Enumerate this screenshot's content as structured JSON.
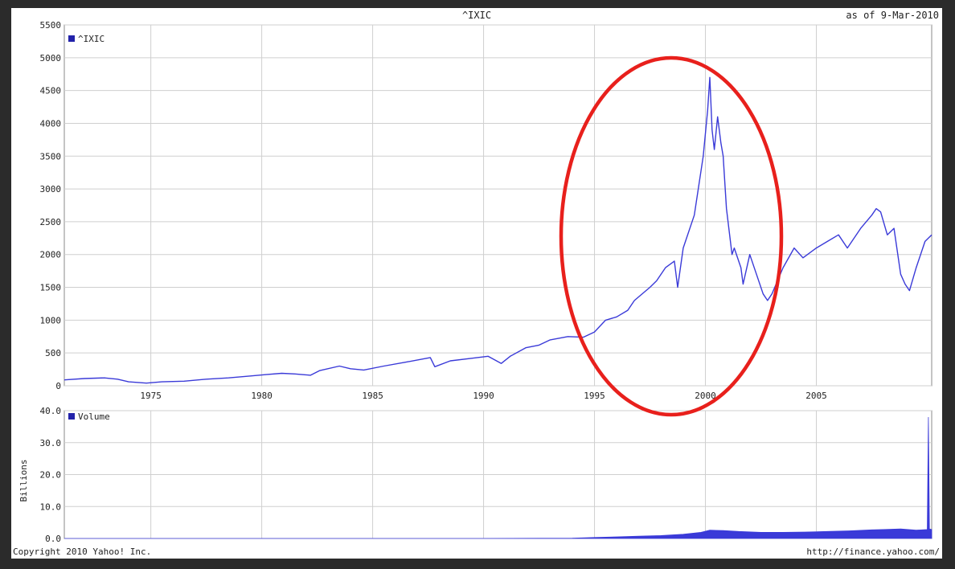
{
  "header": {
    "title": "^IXIC",
    "as_of": "as of  9-Mar-2010"
  },
  "footer": {
    "copyright": "Copyright 2010 Yahoo! Inc.",
    "url": "http://finance.yahoo.com/"
  },
  "colors": {
    "line": "#3a3ad8",
    "grid": "#cfcfcf",
    "annotation": "#e8201c",
    "background": "#2b2b2b"
  },
  "chart_data": [
    {
      "type": "line",
      "legend": "^IXIC",
      "legend_placement": "top-left",
      "grid": true,
      "xlim": [
        1971.1,
        2010.2
      ],
      "ylim": [
        0,
        5500
      ],
      "x_ticks": [
        "1975",
        "1980",
        "1985",
        "1990",
        "1995",
        "2000",
        "2005"
      ],
      "y_ticks": [
        "0",
        "500",
        "1000",
        "1500",
        "2000",
        "2500",
        "3000",
        "3500",
        "4000",
        "4500",
        "5000",
        "5500"
      ],
      "series": [
        {
          "name": "^IXIC",
          "x": [
            1971.1,
            1972.0,
            1972.9,
            1973.5,
            1974.0,
            1974.8,
            1975.5,
            1976.5,
            1977.5,
            1978.5,
            1979.5,
            1980.2,
            1980.9,
            1981.5,
            1982.2,
            1982.6,
            1983.5,
            1984.0,
            1984.6,
            1985.5,
            1986.5,
            1987.6,
            1987.8,
            1988.5,
            1989.5,
            1990.2,
            1990.8,
            1991.2,
            1991.9,
            1992.5,
            1993.0,
            1993.8,
            1994.5,
            1995.0,
            1995.5,
            1996.0,
            1996.5,
            1996.8,
            1997.5,
            1997.8,
            1998.2,
            1998.6,
            1998.75,
            1999.0,
            1999.5,
            1999.9,
            2000.1,
            2000.2,
            2000.3,
            2000.4,
            2000.55,
            2000.7,
            2000.8,
            2000.95,
            2001.2,
            2001.3,
            2001.6,
            2001.7,
            2002.0,
            2002.3,
            2002.6,
            2002.8,
            2003.0,
            2003.5,
            2004.0,
            2004.4,
            2004.6,
            2005.0,
            2005.5,
            2006.0,
            2006.4,
            2006.6,
            2007.0,
            2007.5,
            2007.7,
            2007.9,
            2008.2,
            2008.5,
            2008.8,
            2009.0,
            2009.2,
            2009.5,
            2009.9,
            2010.2
          ],
          "values": [
            90,
            110,
            120,
            100,
            60,
            40,
            60,
            70,
            100,
            120,
            150,
            170,
            190,
            180,
            160,
            230,
            300,
            260,
            240,
            300,
            360,
            430,
            290,
            380,
            420,
            450,
            340,
            450,
            580,
            620,
            700,
            750,
            740,
            820,
            1000,
            1050,
            1150,
            1300,
            1500,
            1600,
            1800,
            1900,
            1500,
            2100,
            2600,
            3500,
            4200,
            4700,
            3900,
            3600,
            4100,
            3700,
            3500,
            2700,
            2000,
            2100,
            1800,
            1550,
            2000,
            1700,
            1400,
            1300,
            1400,
            1800,
            2100,
            1950,
            2000,
            2100,
            2200,
            2300,
            2100,
            2200,
            2400,
            2600,
            2700,
            2650,
            2300,
            2400,
            1700,
            1550,
            1450,
            1800,
            2200,
            2300
          ]
        }
      ]
    },
    {
      "type": "area",
      "legend": "Volume",
      "legend_placement": "top-left",
      "ylabel": "Billions",
      "grid": true,
      "xlim": [
        1971.1,
        2010.2
      ],
      "ylim": [
        0,
        40
      ],
      "y_ticks": [
        "0.0",
        "10.0",
        "20.0",
        "30.0",
        "40.0"
      ],
      "series": [
        {
          "name": "Volume",
          "x": [
            1971.1,
            1990.0,
            1994.0,
            1995.0,
            1996.0,
            1997.0,
            1998.0,
            1999.0,
            1999.8,
            2000.2,
            2000.8,
            2001.5,
            2002.5,
            2003.5,
            2004.5,
            2005.5,
            2006.5,
            2007.5,
            2008.0,
            2008.8,
            2009.5,
            2010.0,
            2010.05,
            2010.1,
            2010.2
          ],
          "values": [
            0,
            0,
            0.1,
            0.3,
            0.5,
            0.7,
            0.9,
            1.3,
            1.9,
            2.6,
            2.5,
            2.2,
            1.9,
            1.9,
            2.0,
            2.2,
            2.4,
            2.7,
            2.8,
            3.0,
            2.6,
            2.8,
            38.0,
            3.0,
            2.8
          ]
        }
      ]
    }
  ]
}
